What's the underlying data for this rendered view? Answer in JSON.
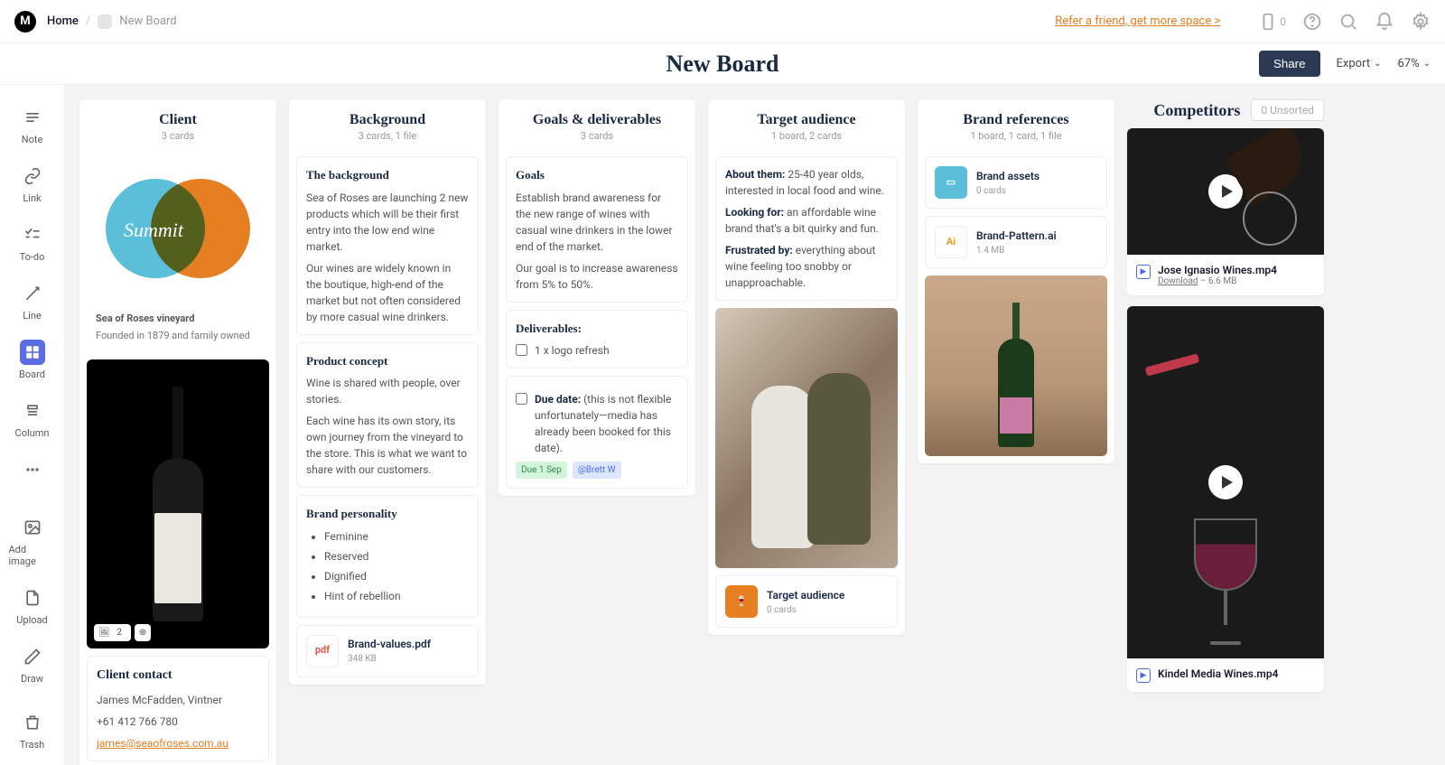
{
  "breadcrumb": {
    "home": "Home",
    "current": "New Board"
  },
  "topbar": {
    "refer": "Refer a friend, get more space >",
    "mobile_count": "0"
  },
  "titlebar": {
    "title": "New Board",
    "share": "Share",
    "export": "Export",
    "zoom": "67%"
  },
  "sidebar": {
    "tools": [
      {
        "label": "Note"
      },
      {
        "label": "Link"
      },
      {
        "label": "To-do"
      },
      {
        "label": "Line"
      },
      {
        "label": "Board"
      },
      {
        "label": "Column"
      },
      {
        "label": ""
      },
      {
        "label": "Add image"
      },
      {
        "label": "Upload"
      },
      {
        "label": "Draw"
      },
      {
        "label": "Trash"
      }
    ]
  },
  "unsorted_label": "0 Unsorted",
  "competitors_title": "Competitors",
  "columns": {
    "client": {
      "title": "Client",
      "meta": "3 cards",
      "logo": {
        "venn_text": "Summit",
        "name": "Sea of Roses vineyard",
        "sub": "Founded in 1879 and family owned"
      },
      "contact": {
        "title": "Client contact",
        "name": "James McFadden, Vintner",
        "phone": "+61 412 766 780",
        "email": "james@seaofroses.com.au"
      },
      "badge_count": "2"
    },
    "background": {
      "title": "Background",
      "meta": "3 cards, 1 file",
      "card1": {
        "title": "The background",
        "p1": "Sea of Roses are launching 2 new products which will be their first entry into the low end wine market.",
        "p2": "Our wines are widely known in the boutique, high-end of the market but not often considered by more casual wine drinkers."
      },
      "card2": {
        "title": "Product concept",
        "p1": "Wine is shared with people, over stories.",
        "p2": "Each wine has its own story, its own journey from the vineyard to the store. This is what we want to share with our customers."
      },
      "card3": {
        "title": "Brand personality",
        "items": [
          "Feminine",
          "Reserved",
          "Dignified",
          "Hint of rebellion"
        ]
      },
      "file": {
        "name": "Brand-values.pdf",
        "size": "348 KB"
      }
    },
    "goals": {
      "title": "Goals & deliverables",
      "meta": "3 cards",
      "card1": {
        "title": "Goals",
        "p1": "Establish brand awareness for the new range of wines with casual wine drinkers in the lower end of the market.",
        "p2": "Our goal is to increase awareness from 5% to 50%."
      },
      "card2": {
        "title": "Deliverables:",
        "item1": "1 x logo refresh"
      },
      "card3": {
        "due_label": "Due date:",
        "due_text": "(this is not flexible unfortunately—media has already been booked for this date).",
        "tag1": "Due 1 Sep",
        "tag2": "@Brett W"
      }
    },
    "audience": {
      "title": "Target audience",
      "meta": "1 board, 2 cards",
      "card1": {
        "l1": "About them:",
        "t1": "25-40 year olds, interested in local food and wine.",
        "l2": "Looking for:",
        "t2": "an affordable wine brand that's a bit quirky and fun.",
        "l3": "Frustrated by:",
        "t3": "everything about wine feeling too snobby or unapproachable."
      },
      "folder": {
        "name": "Target audience",
        "sub": "0 cards"
      }
    },
    "brand": {
      "title": "Brand references",
      "meta": "1 board, 1 card, 1 file",
      "folder": {
        "name": "Brand assets",
        "sub": "0 cards"
      },
      "file": {
        "name": "Brand-Pattern.ai",
        "size": "1.4 MB"
      }
    }
  },
  "videos": {
    "v1": {
      "name": "Jose Ignasio Wines.mp4",
      "dl": "Download",
      "size": " – 6.6 MB"
    },
    "v2": {
      "name": "Kindel Media Wines.mp4"
    }
  }
}
